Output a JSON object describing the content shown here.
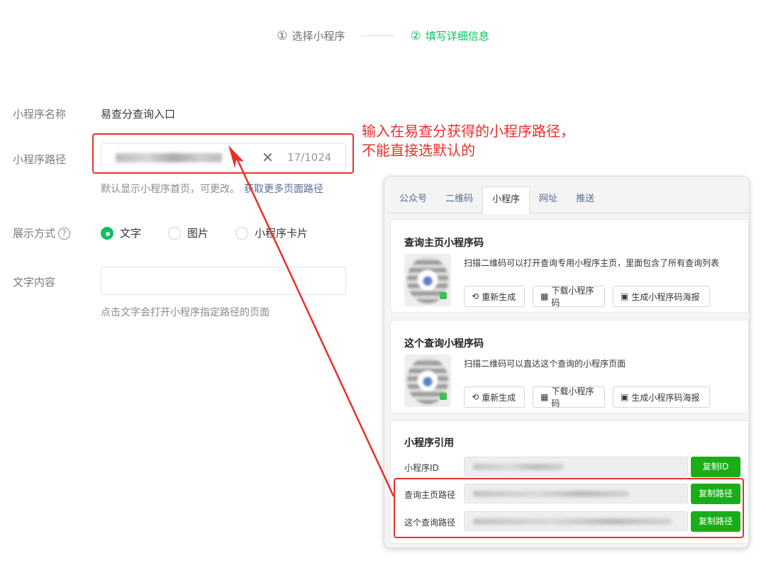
{
  "steps": {
    "step1_num": "①",
    "step1_label": "选择小程序",
    "step2_num": "②",
    "step2_label": "填写详细信息"
  },
  "form": {
    "name_label": "小程序名称",
    "name_value": "易查分查询入口",
    "path_label": "小程序路径",
    "path_counter": "17/1024",
    "path_hint": "默认显示小程序首页，可更改。",
    "path_hint_link": "获取更多页面路径",
    "display_label": "展示方式",
    "display_options": [
      "文字",
      "图片",
      "小程序卡片"
    ],
    "text_label": "文字内容",
    "text_hint": "点击文字会打开小程序指定路径的页面"
  },
  "annotation": {
    "line1": "输入在易查分获得的小程序路径，",
    "line2": "不能直接选默认的",
    "color": "#e8302b"
  },
  "panel": {
    "tabs": [
      "公众号",
      "二维码",
      "小程序",
      "网址",
      "推送"
    ],
    "selected_tab": "小程序",
    "home_card": {
      "title": "查询主页小程序码",
      "desc": "扫描二维码可以打开查询专用小程序主页，里面包含了所有查询列表",
      "btn_regen": "重新生成",
      "btn_download": "下载小程序码",
      "btn_poster": "生成小程序码海报"
    },
    "this_card": {
      "title": "这个查询小程序码",
      "desc": "扫描二维码可以直达这个查询的小程序页面",
      "btn_regen": "重新生成",
      "btn_download": "下载小程序码",
      "btn_poster": "生成小程序码海报"
    },
    "ref_card": {
      "title": "小程序引用",
      "id_label": "小程序ID",
      "id_btn": "复制ID",
      "home_path_label": "查询主页路径",
      "home_path_btn": "复制路径",
      "this_path_label": "这个查询路径",
      "this_path_btn": "复制路径"
    }
  },
  "colors": {
    "accent": "#07c160",
    "link": "#576b95",
    "copy_button": "#1aad19"
  }
}
